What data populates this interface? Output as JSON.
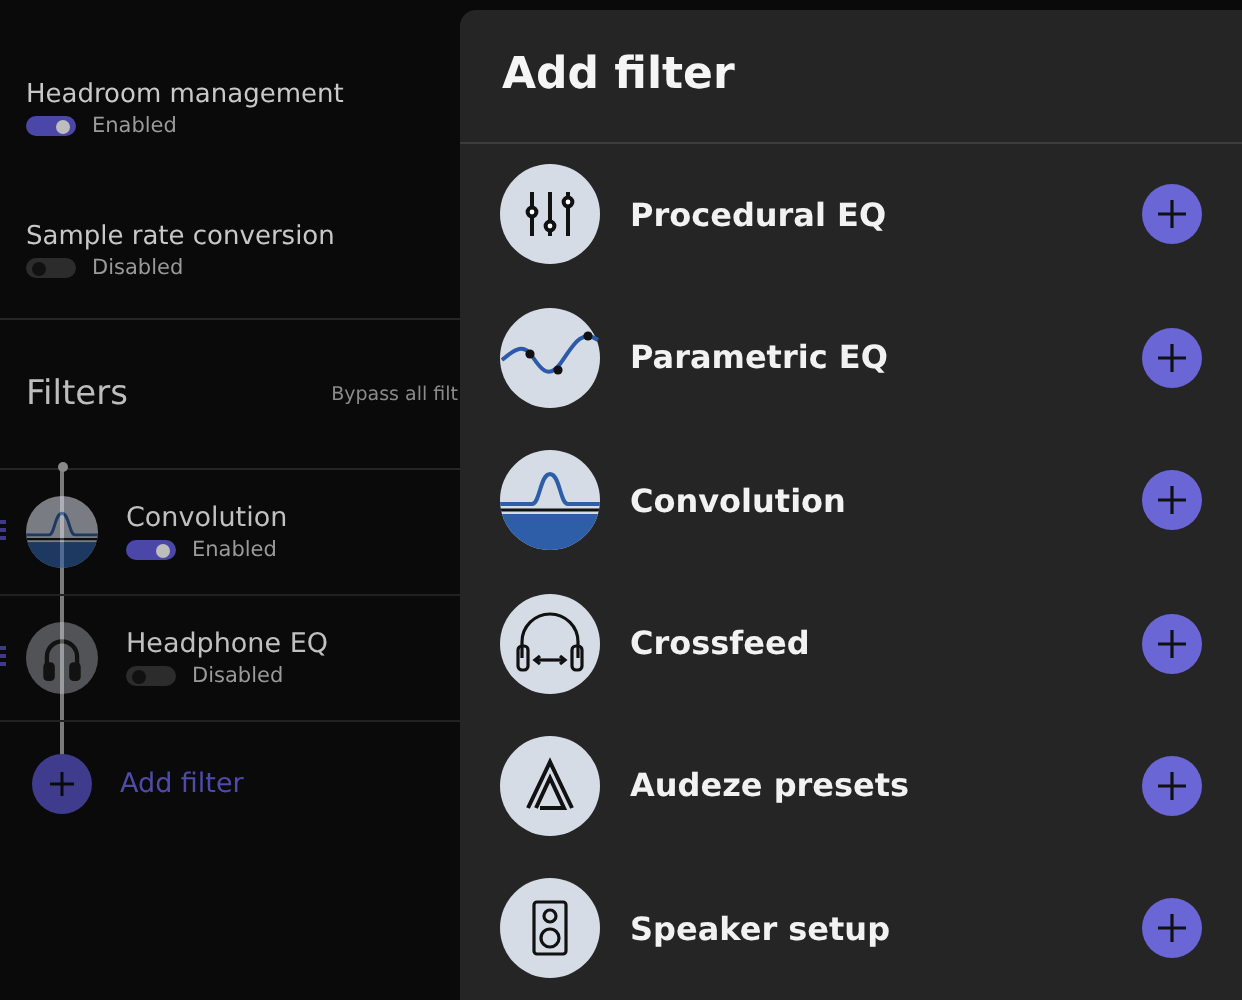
{
  "settings": [
    {
      "title": "Headroom management",
      "on": true,
      "status": "Enabled"
    },
    {
      "title": "Sample rate conversion",
      "on": false,
      "status": "Disabled"
    }
  ],
  "filters": {
    "title": "Filters",
    "bypass": "Bypass all filt",
    "items": [
      {
        "kind": "convolution",
        "name": "Convolution",
        "on": true,
        "status": "Enabled"
      },
      {
        "kind": "headphone",
        "name": "Headphone EQ",
        "on": false,
        "status": "Disabled"
      }
    ],
    "add": "Add filter"
  },
  "drawer": {
    "title": "Add filter",
    "items": [
      {
        "kind": "sliders",
        "name": "Procedural EQ"
      },
      {
        "kind": "parametric",
        "name": "Parametric EQ"
      },
      {
        "kind": "convolution",
        "name": "Convolution"
      },
      {
        "kind": "crossfeed",
        "name": "Crossfeed"
      },
      {
        "kind": "audeze",
        "name": "Audeze presets"
      },
      {
        "kind": "speaker",
        "name": "Speaker setup"
      }
    ]
  }
}
